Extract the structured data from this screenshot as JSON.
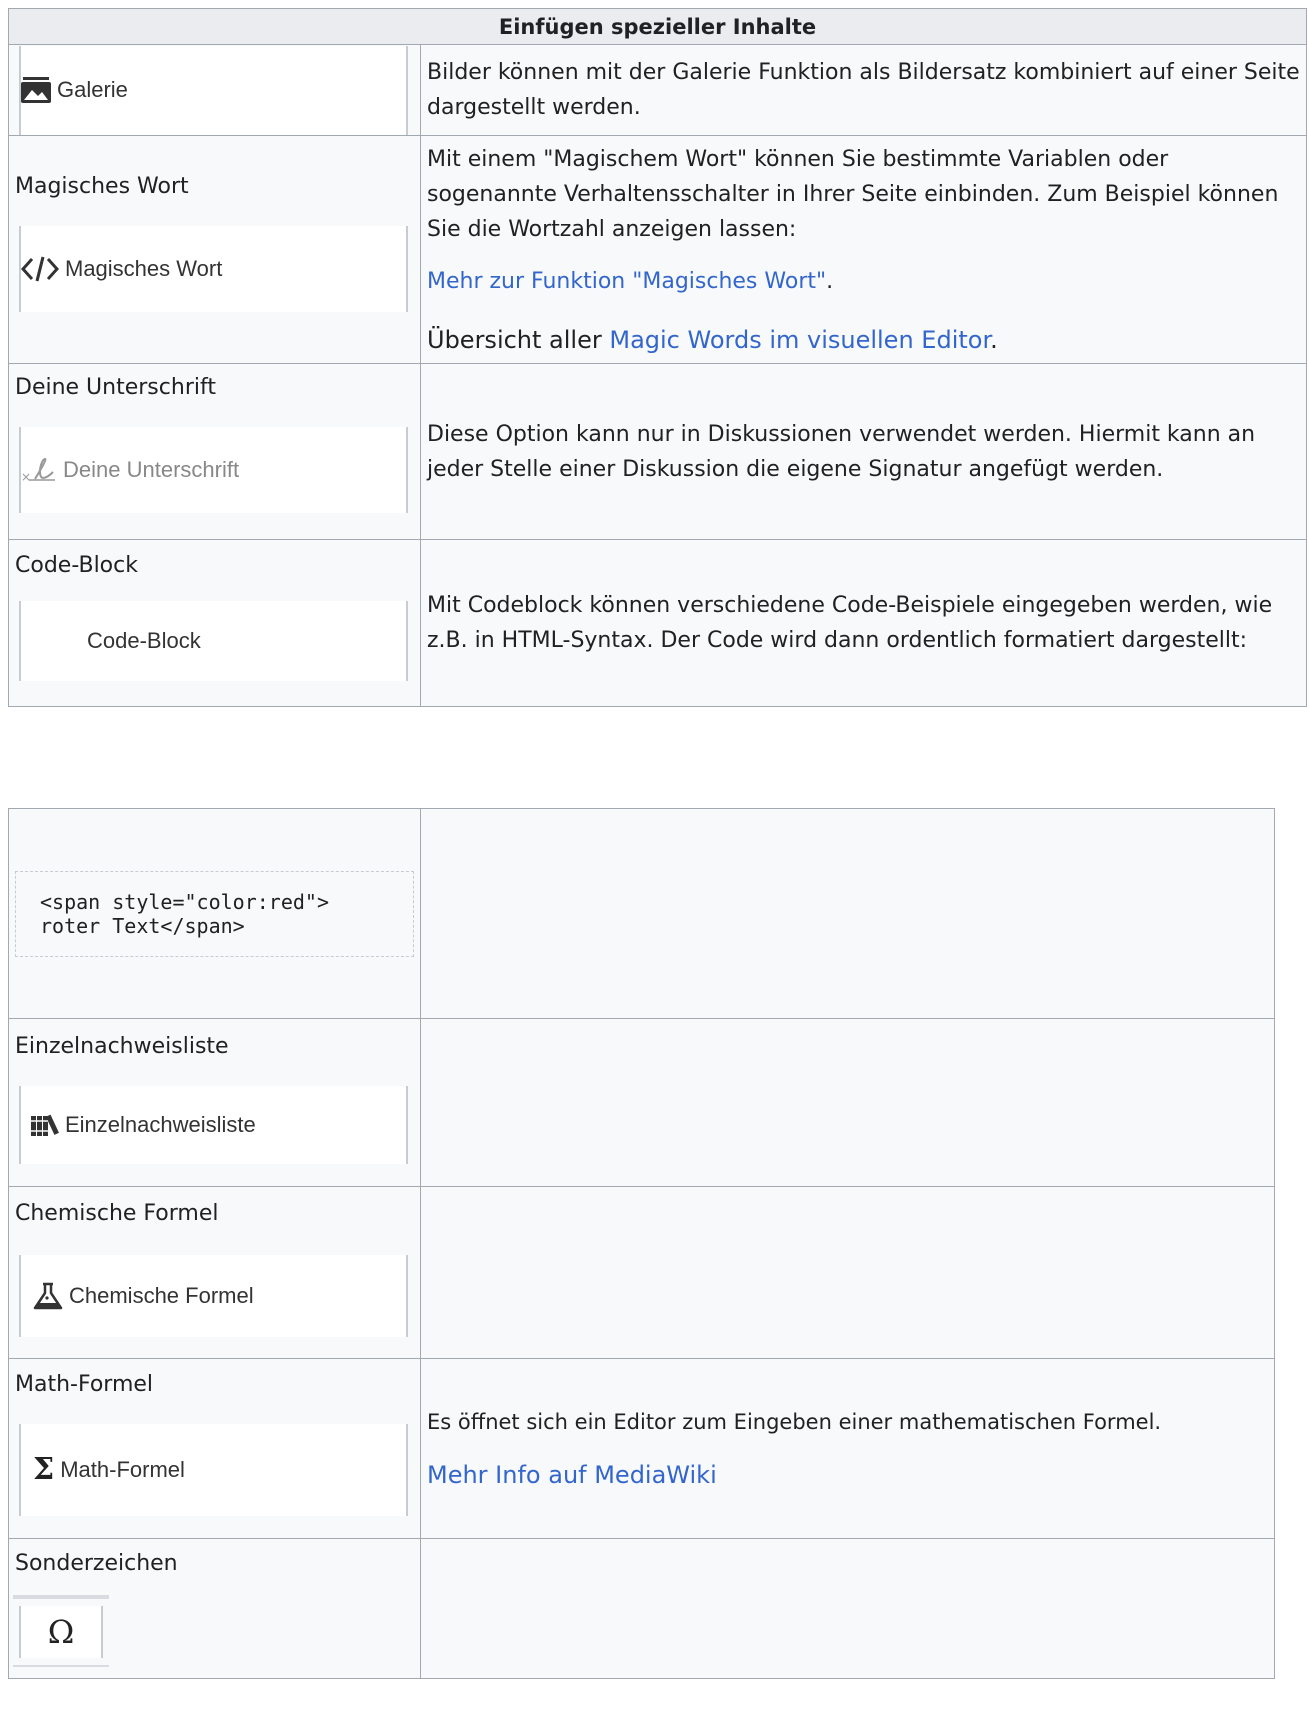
{
  "table1": {
    "header": "Einfügen spezieller Inhalte",
    "rows": {
      "galerie": {
        "button": "Galerie",
        "desc": "Bilder können mit der Galerie Funktion als Bildersatz kombiniert auf einer Seite dargestellt werden."
      },
      "magic": {
        "label": "Magisches Wort",
        "button": "Magisches Wort",
        "desc": "Mit einem \"Magischem Wort\" können Sie bestimmte Variablen oder sogenannte Verhaltensschalter in Ihrer Seite einbinden. Zum Beispiel können Sie die Wortzahl anzeigen lassen:",
        "link1": "Mehr zur Funktion \"Magisches Wort\"",
        "link1_suffix": ".",
        "overview_prefix": "Übersicht aller ",
        "link2": "Magic Words im visuellen Editor",
        "overview_suffix": "."
      },
      "signature": {
        "label": "Deine Unterschrift",
        "button": "Deine Unterschrift",
        "desc": "Diese Option kann nur in Diskussionen verwendet werden. Hiermit kann an jeder Stelle einer Diskussion die eigene Signatur angefügt werden."
      },
      "codeblock": {
        "label": "Code-Block",
        "button": "Code-Block",
        "desc": "Mit Codeblock können verschiedene Code-Beispiele eingegeben werden, wie z.B. in HTML-Syntax. Der Code wird dann ordentlich formatiert dargestellt:"
      }
    }
  },
  "table2": {
    "code_example": "<span style=\"color:red\">\nroter Text</span>",
    "rows": {
      "refs": {
        "label": "Einzelnachweisliste",
        "button": "Einzelnachweisliste"
      },
      "chem": {
        "label": "Chemische Formel",
        "button": "Chemische Formel"
      },
      "math": {
        "label": "Math-Formel",
        "button": "Math-Formel",
        "desc": "Es öffnet sich ein Editor zum Eingeben einer mathematischen Formel.",
        "link": "Mehr Info auf MediaWiki"
      },
      "special": {
        "label": "Sonderzeichen",
        "icon_glyph": "Ω"
      }
    }
  },
  "colors": {
    "link": "#3366cc",
    "border": "#a2a9b1",
    "header_bg": "#eaecf0",
    "cell_bg": "#f8f9fa"
  }
}
